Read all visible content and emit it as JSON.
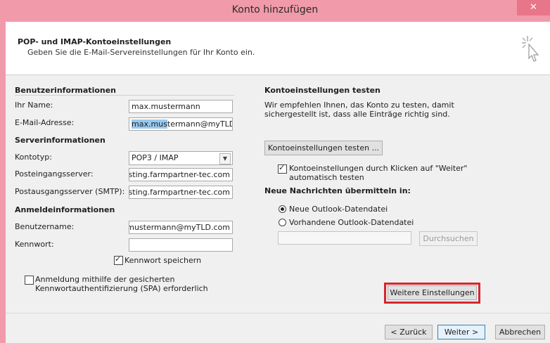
{
  "window": {
    "title": "Konto hinzufügen",
    "close_glyph": "✕"
  },
  "header": {
    "title": "POP- und IMAP-Kontoeinstellungen",
    "subtitle": "Geben Sie die E-Mail-Servereinstellungen für Ihr Konto ein."
  },
  "user_info": {
    "section": "Benutzerinformationen",
    "name_label": "Ihr Name:",
    "name_value": "max.mustermann",
    "email_label": "E-Mail-Adresse:",
    "email_value_selected": "max.mus",
    "email_value_rest": "termann@myTLD.co"
  },
  "server_info": {
    "section": "Serverinformationen",
    "account_type_label": "Kontotyp:",
    "account_type_value": "POP3  / IMAP",
    "incoming_label": "Posteingangsserver:",
    "incoming_value": "hosting.farmpartner-tec.com",
    "outgoing_label": "Postausgangsserver (SMTP):",
    "outgoing_value": "hosting.farmpartner-tec.com"
  },
  "login_info": {
    "section": "Anmeldeinformationen",
    "username_label": "Benutzername:",
    "username_value": "max.mustermann@myTLD.com",
    "password_label": "Kennwort:",
    "password_value": "",
    "save_password_label": "Kennwort speichern",
    "spa_label_line1": "Anmeldung mithilfe der gesicherten",
    "spa_label_line2": "Kennwortauthentifizierung (SPA) erforderlich"
  },
  "test_settings": {
    "section": "Kontoeinstellungen testen",
    "description_line1": "Wir empfehlen Ihnen, das Konto zu testen, damit",
    "description_line2": "sichergestellt ist, dass alle Einträge richtig sind.",
    "test_button": "Kontoeinstellungen testen ...",
    "auto_test_line1": "Kontoeinstellungen durch Klicken auf \"Weiter\"",
    "auto_test_line2": "automatisch testen"
  },
  "deliver": {
    "section": "Neue Nachrichten übermitteln in:",
    "new_file_label": "Neue Outlook-Datendatei",
    "existing_file_label": "Vorhandene Outlook-Datendatei",
    "browse_button": "Durchsuchen"
  },
  "more_settings_button": "Weitere Einstellungen",
  "footer": {
    "back": "< Zurück",
    "next": "Weiter >",
    "cancel": "Abbrechen"
  },
  "colors": {
    "titlebar": "#f19aa9",
    "highlight": "#d8262e",
    "selection": "#99c9ef"
  }
}
